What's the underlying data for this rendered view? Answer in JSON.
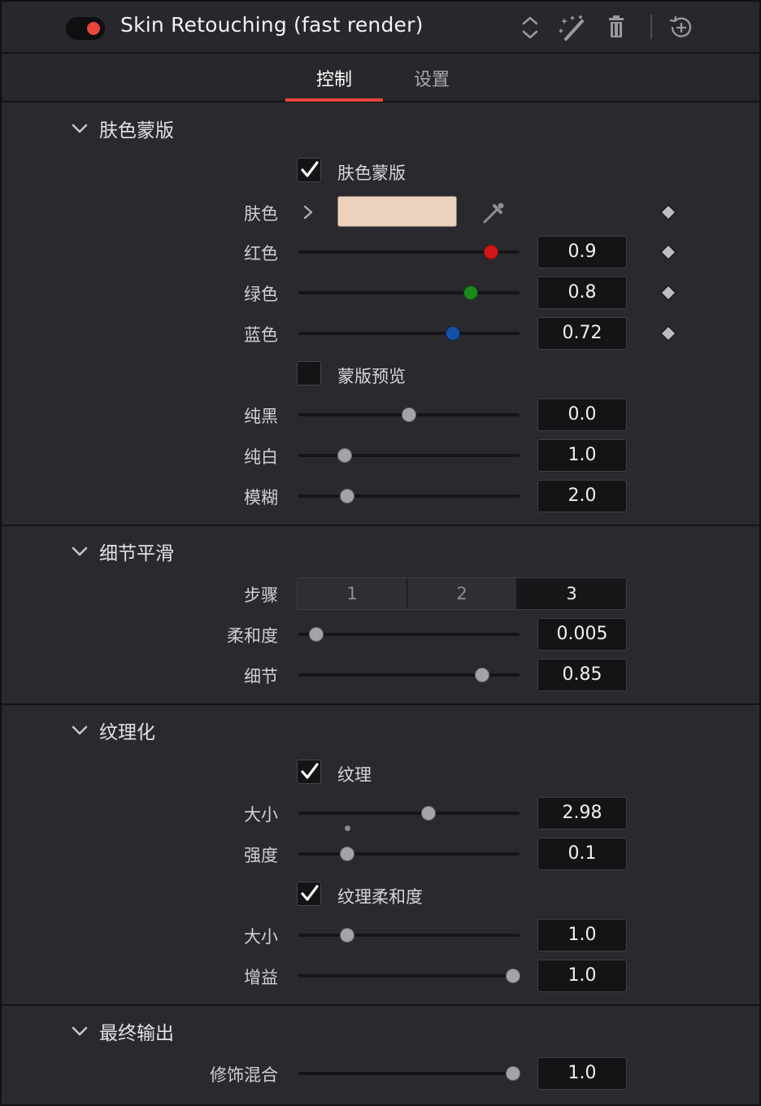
{
  "header": {
    "title": "Skin Retouching (fast render)",
    "enabled": true,
    "icons": [
      "expand-collapse-icon",
      "magic-wand-icon",
      "trash-icon",
      "reset-icon"
    ]
  },
  "tabs": [
    {
      "label": "控制",
      "active": true
    },
    {
      "label": "设置",
      "active": false
    }
  ],
  "colors": {
    "accent": "#e8453c",
    "skin_swatch": "#ecd2bd",
    "red_knob": "#d01818",
    "green_knob": "#1a8a1a",
    "blue_knob": "#1650a8"
  },
  "skin_mask": {
    "title": "肤色蒙版",
    "enable_label": "肤色蒙版",
    "enable_checked": true,
    "skin_label": "肤色",
    "red": {
      "label": "红色",
      "value": "0.9",
      "fraction": 0.87
    },
    "green": {
      "label": "绿色",
      "value": "0.8",
      "fraction": 0.78
    },
    "blue": {
      "label": "蓝色",
      "value": "0.72",
      "fraction": 0.7
    },
    "preview_label": "蒙版预览",
    "preview_checked": false,
    "black": {
      "label": "纯黑",
      "value": "0.0",
      "fraction": 0.5
    },
    "white": {
      "label": "纯白",
      "value": "1.0",
      "fraction": 0.21
    },
    "blur": {
      "label": "模糊",
      "value": "2.0",
      "fraction": 0.22
    }
  },
  "detail_smoothing": {
    "title": "细节平滑",
    "steps_label": "步骤",
    "steps_options": [
      "1",
      "2",
      "3"
    ],
    "steps_selected": "3",
    "softness": {
      "label": "柔和度",
      "value": "0.005",
      "fraction": 0.08
    },
    "detail": {
      "label": "细节",
      "value": "0.85",
      "fraction": 0.83
    }
  },
  "texturize": {
    "title": "纹理化",
    "texture_label": "纹理",
    "texture_checked": true,
    "size": {
      "label": "大小",
      "value": "2.98",
      "fraction": 0.59
    },
    "strength": {
      "label": "强度",
      "value": "0.1",
      "fraction": 0.22
    },
    "tex_softness_label": "纹理柔和度",
    "tex_softness_checked": true,
    "soft_size": {
      "label": "大小",
      "value": "1.0",
      "fraction": 0.22
    },
    "gain": {
      "label": "增益",
      "value": "1.0",
      "fraction": 0.97
    }
  },
  "final_output": {
    "title": "最终输出",
    "blend": {
      "label": "修饰混合",
      "value": "1.0",
      "fraction": 0.97
    }
  }
}
